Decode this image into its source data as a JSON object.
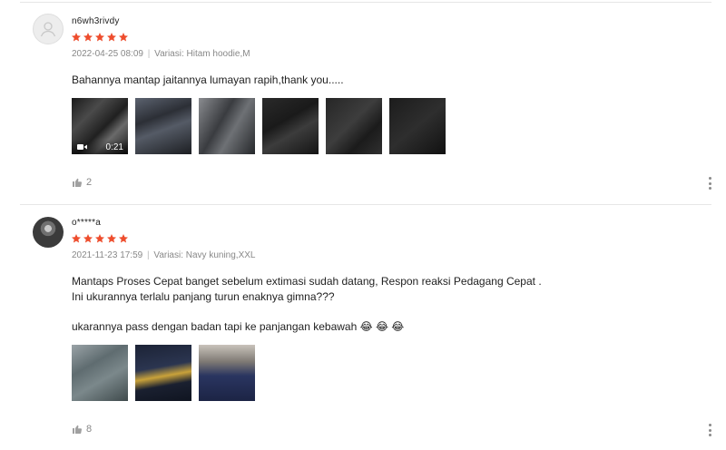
{
  "reviews": [
    {
      "username": "n6wh3rivdy",
      "rating": 5,
      "date": "2022-04-25 08:09",
      "separator": "|",
      "variation": "Variasi: Hitam hoodie,M",
      "comment": "Bahannya mantap jaitannya lumayan rapih,thank you.....",
      "video_duration": "0:21",
      "likes": "2"
    },
    {
      "username": "o*****a",
      "rating": 5,
      "date": "2021-11-23 17:59",
      "separator": "|",
      "variation": "Variasi: Navy kuning,XXL",
      "comment": "Mantaps Proses Cepat banget sebelum extimasi sudah datang, Respon reaksi Pedagang Cepat .\nIni ukurannya terlalu panjang turun enaknya gimna???\n\nukarannya pass dengan badan tapi ke panjangan kebawah 😂 😂 😂",
      "likes": "8"
    }
  ],
  "colors": {
    "star": "#ee4d2d",
    "meta": "#888888",
    "divider": "#e6e6e6"
  },
  "icons": [
    "star-icon",
    "video-camera-icon",
    "thumbs-up-icon",
    "more-vertical-icon",
    "avatar-placeholder-icon"
  ]
}
